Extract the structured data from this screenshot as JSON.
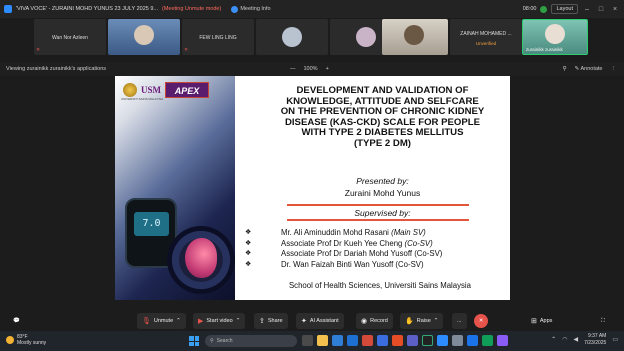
{
  "titlebar": {
    "title": "'VIVA VOCE' - ZURAINI MOHD YUNUS 23 JULY 2025 9...",
    "unmute_note": "(Meeting Unmute mode)",
    "meeting_info": "Meeting Info",
    "timer": "08:00",
    "layout": "Layout"
  },
  "participants": [
    {
      "name": "Wan Nor Azleen"
    },
    {
      "name": ""
    },
    {
      "name": "FEW LING LING"
    },
    {
      "name": ""
    },
    {
      "name": ""
    },
    {
      "name": ""
    },
    {
      "name": "ZAINAH MOHAMED ...",
      "status": "Unverified"
    },
    {
      "name": "zurainikk zurainikk"
    }
  ],
  "sharebar": {
    "viewing": "Viewing zurainikk zurainikk's applications",
    "zoom_minus": "—",
    "zoom_level": "100%",
    "zoom_plus": "+",
    "view_options": "View",
    "annotate": "Annotate"
  },
  "slide": {
    "logo_usm": "USM",
    "logo_apex": "APEX",
    "logo_sub": "UNIVERSITI SAINS MALAYSIA",
    "glucometer_reading": "7.0",
    "title_lines": [
      "DEVELOPMENT AND VALIDATION OF",
      "KNOWLEDGE, ATTITUDE AND SELFCARE",
      "ON THE PREVENTION OF CHRONIC KIDNEY",
      "DISEASE (KAS-CKD) SCALE FOR PEOPLE",
      "WITH TYPE 2 DIABETES MELLITUS",
      "(TYPE 2 DM)"
    ],
    "presented_by": "Presented by:",
    "presenter": "Zuraini Mohd Yunus",
    "supervised_by": "Supervised by:",
    "supervisors": [
      {
        "name": "Mr. Ali Aminuddin Mohd Rasani",
        "role": "(Main SV)"
      },
      {
        "name": "Associate Prof Dr Kueh Yee Cheng",
        "role": "(Co-SV)"
      },
      {
        "name": "Associate Prof Dr Dariah Mohd Yusoff",
        "role": "(Co-SV)"
      },
      {
        "name": "Dr. Wan Faizah Binti Wan Yusoff",
        "role": "(Co-SV)"
      }
    ],
    "school": "School of Health Sciences, Universiti Sains  Malaysia"
  },
  "toolbar": {
    "unmute": "Unmute",
    "start_video": "Start video",
    "share": "Share",
    "ai_assistant": "AI Assistant",
    "record": "Record",
    "raise": "Raise",
    "more": "...",
    "apps": "Apps"
  },
  "taskbar": {
    "weather_temp": "83°F",
    "weather_desc": "Mostly sunny",
    "search_placeholder": "Search",
    "time": "9:37 AM",
    "date": "7/23/2025"
  }
}
